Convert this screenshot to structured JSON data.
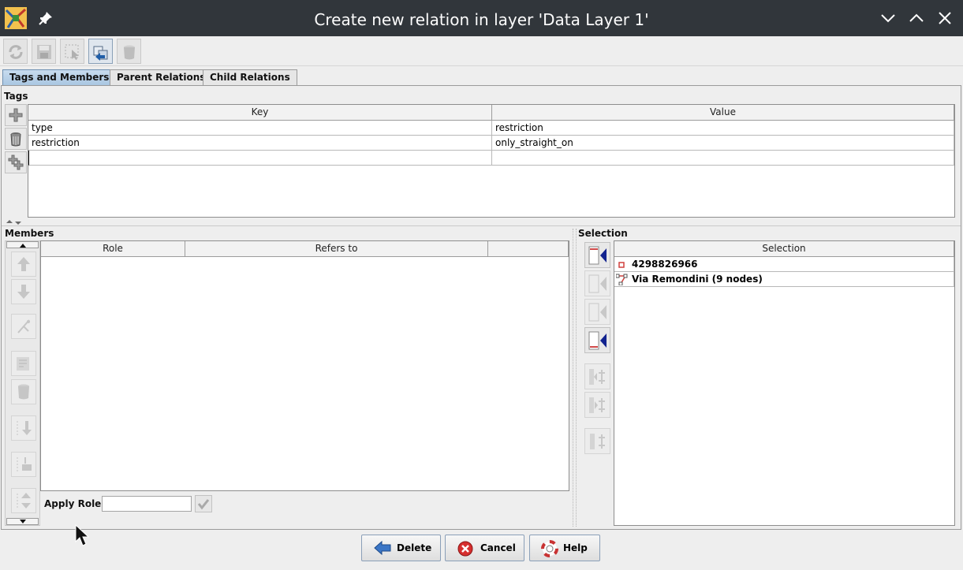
{
  "window": {
    "title": "Create new relation in layer 'Data Layer 1'"
  },
  "tabs": [
    {
      "label": "Tags and Members",
      "active": true
    },
    {
      "label": "Parent Relations",
      "active": false
    },
    {
      "label": "Child Relations",
      "active": false
    }
  ],
  "tags": {
    "section_label": "Tags",
    "columns": [
      "Key",
      "Value"
    ],
    "rows": [
      {
        "key": "type",
        "value": "restriction"
      },
      {
        "key": "restriction",
        "value": "only_straight_on"
      },
      {
        "key": "",
        "value": ""
      }
    ]
  },
  "members": {
    "section_label": "Members",
    "columns": [
      "Role",
      "Refers to",
      ""
    ],
    "apply_role_label": "Apply Role:",
    "apply_role_value": ""
  },
  "selection": {
    "section_label": "Selection",
    "column": "Selection",
    "items": [
      {
        "label": "4298826966",
        "type": "node"
      },
      {
        "label": "Via Remondini (9 nodes)",
        "type": "way"
      }
    ]
  },
  "buttons": {
    "delete": "Delete",
    "cancel": "Cancel",
    "help": "Help"
  },
  "colors": {
    "titlebar": "#31363b",
    "tab_active": "#b8d0e8",
    "cancel_red": "#d62f2f",
    "delete_blue": "#3b76c6"
  }
}
